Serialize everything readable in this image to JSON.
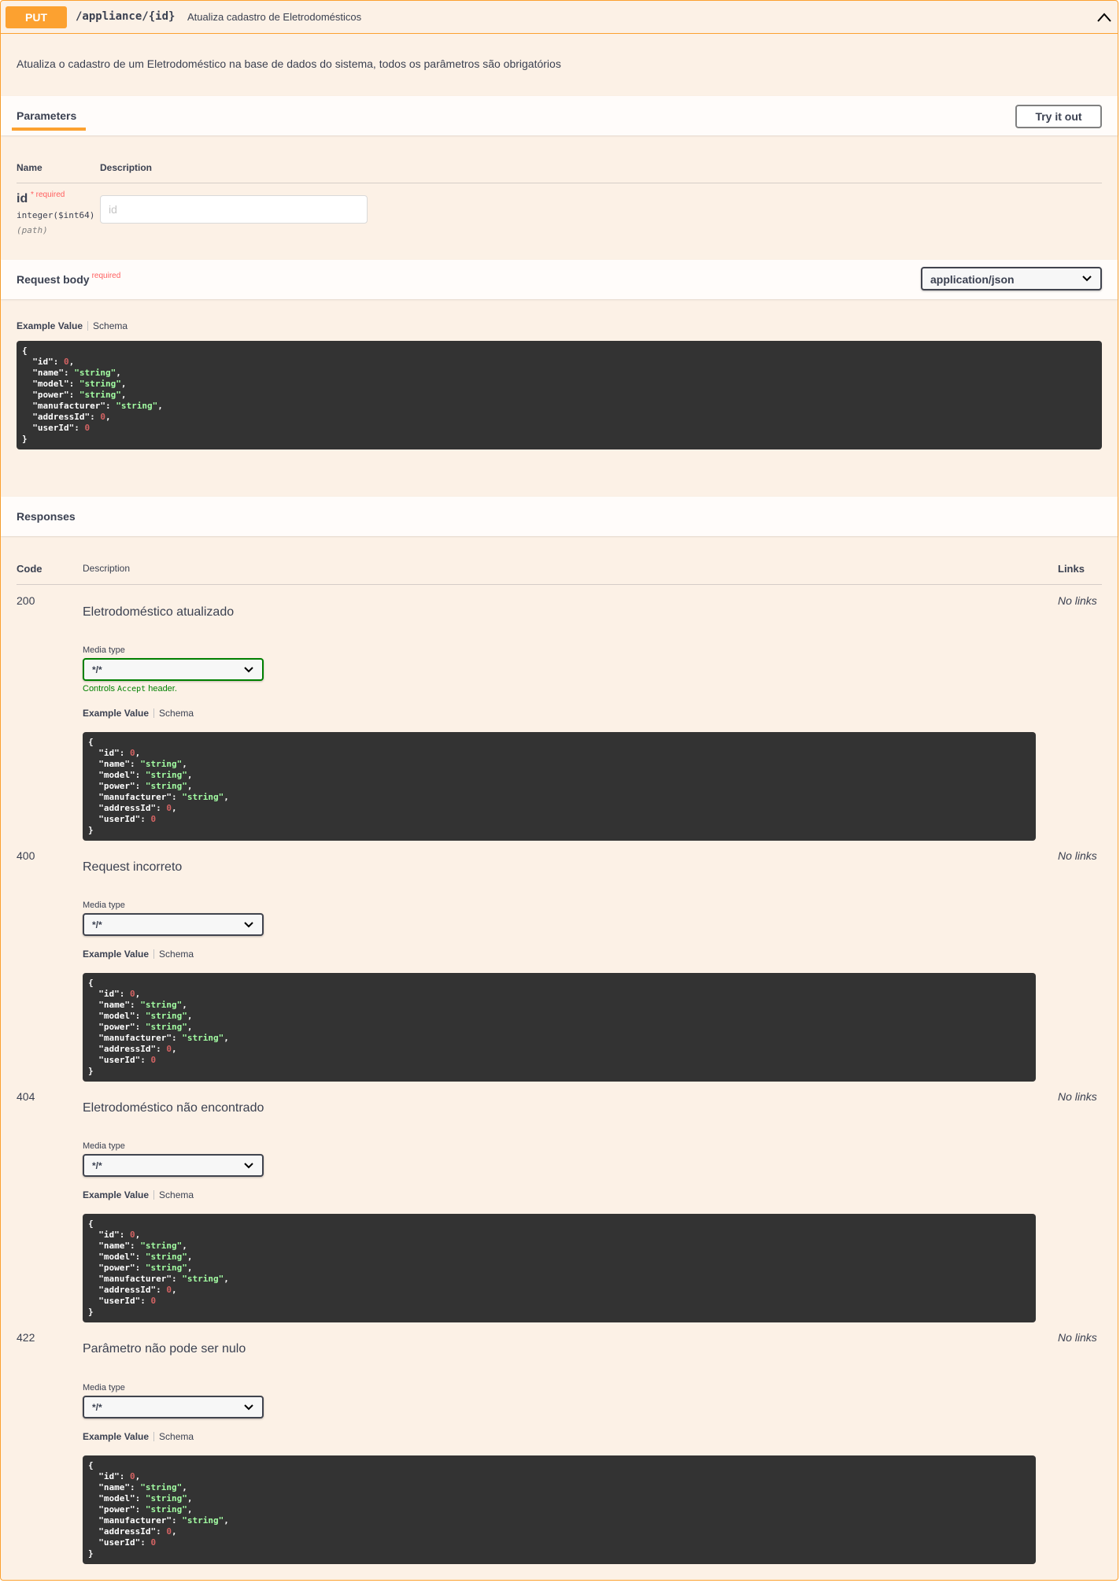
{
  "operation": {
    "method": "PUT",
    "path": "/appliance/{id}",
    "summary": "Atualiza cadastro de Eletrodomésticos",
    "description": "Atualiza o cadastro de um Eletrodoméstico na base de dados do sistema, todos os parâmetros são obrigatórios"
  },
  "parameters": {
    "title": "Parameters",
    "try_label": "Try it out",
    "col_name": "Name",
    "col_description": "Description",
    "items": [
      {
        "name": "id",
        "required_mark": "* required",
        "type": "integer($int64)",
        "in": "(path)",
        "placeholder": "id"
      }
    ]
  },
  "request_body": {
    "title": "Request body",
    "required": "required",
    "content_type": "application/json",
    "tab_example": "Example Value",
    "tab_schema": "Schema"
  },
  "example_json": [
    {
      "key": "\"id\"",
      "value": "0",
      "kind": "num"
    },
    {
      "key": "\"name\"",
      "value": "\"string\"",
      "kind": "str"
    },
    {
      "key": "\"model\"",
      "value": "\"string\"",
      "kind": "str"
    },
    {
      "key": "\"power\"",
      "value": "\"string\"",
      "kind": "str"
    },
    {
      "key": "\"manufacturer\"",
      "value": "\"string\"",
      "kind": "str"
    },
    {
      "key": "\"addressId\"",
      "value": "0",
      "kind": "num"
    },
    {
      "key": "\"userId\"",
      "value": "0",
      "kind": "num"
    }
  ],
  "responses": {
    "title": "Responses",
    "col_code": "Code",
    "col_description": "Description",
    "col_links": "Links",
    "media_type_label": "Media type",
    "controls_prefix": "Controls ",
    "controls_code": "Accept",
    "controls_suffix": " header.",
    "items": [
      {
        "code": "200",
        "description": "Eletrodoméstico atualizado",
        "media_type": "*/*",
        "links": "No links",
        "tab_example": "Example Value",
        "tab_schema": "Schema"
      },
      {
        "code": "400",
        "description": "Request incorreto",
        "media_type": "*/*",
        "links": "No links",
        "tab_example": "Example Value",
        "tab_schema": "Schema"
      },
      {
        "code": "404",
        "description": "Eletrodoméstico não encontrado",
        "media_type": "*/*",
        "links": "No links",
        "tab_example": "Example Value",
        "tab_schema": "Schema"
      },
      {
        "code": "422",
        "description": "Parâmetro não pode ser nulo",
        "media_type": "*/*",
        "links": "No links",
        "tab_example": "Example Value",
        "tab_schema": "Schema"
      }
    ]
  },
  "colors": {
    "method_put": "#fca130",
    "background": "#fcf1e6",
    "code_bg": "#333333",
    "json_string": "#a2fca2",
    "json_number": "#d36363",
    "required": "#ff6060",
    "focus_green": "#008000"
  }
}
